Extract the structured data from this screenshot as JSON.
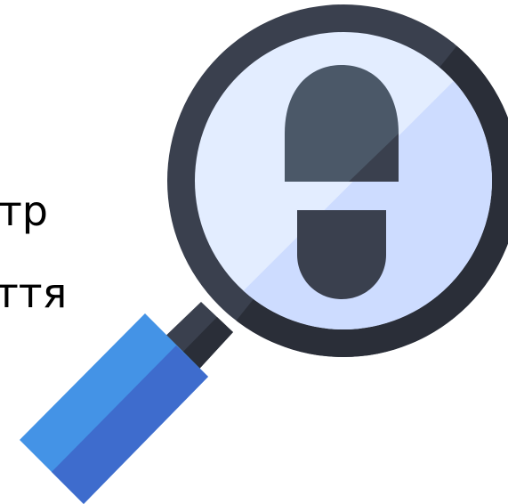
{
  "text": {
    "line_1": "тр",
    "line_2": "ття"
  },
  "icon": {
    "name": "magnifier-footprint-icon",
    "colors": {
      "ring_dark": "#3a404e",
      "ring_shadow": "#2a2e38",
      "lens_light": "#e3edff",
      "lens_shade": "#cddcff",
      "footprint_top": "#4b5868",
      "footprint_heel": "#3a404e",
      "handle_light": "#4493e6",
      "handle_dark": "#3e6ccd",
      "neck": "#2a2e38"
    }
  }
}
